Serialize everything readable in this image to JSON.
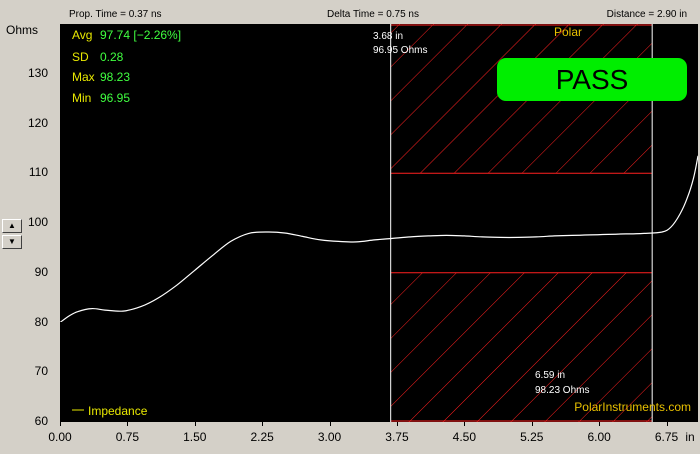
{
  "header": {
    "prop_time": "Prop. Time = 0.37 ns",
    "delta_time": "Delta Time = 0.75 ns",
    "distance": "Distance = 2.90 in"
  },
  "stats": {
    "avg_label": "Avg",
    "avg_value": "97.74 [−2.26%]",
    "sd_label": "SD",
    "sd_value": "0.28",
    "max_label": "Max",
    "max_value": "98.23",
    "min_label": "Min",
    "min_value": "96.95"
  },
  "result": {
    "pass_label": "PASS"
  },
  "brand": {
    "tag": "Polar",
    "site": "PolarInstruments.com"
  },
  "cursors": {
    "left_pos": "3.68 in",
    "left_value": "96.95 Ohms",
    "right_pos": "6.59 in",
    "right_value": "98.23 Ohms"
  },
  "spinner": {
    "up": "▲",
    "down": "▼"
  },
  "colors": {
    "plot_bg": "#000000",
    "trace": "#ffffff",
    "limit": "#ff2020",
    "cursor": "#ffffff",
    "stats_label": "#e8e800",
    "stats_value": "#40ff40",
    "pass_bg": "#00ee00",
    "brand": "#e8c000"
  },
  "chart_data": {
    "type": "line",
    "xlabel": "in",
    "ylabel": "Ohms",
    "xlim": [
      0,
      7.1
    ],
    "ylim": [
      60,
      140
    ],
    "xticks": [
      "0.00",
      "0.75",
      "1.50",
      "2.25",
      "3.00",
      "3.75",
      "4.50",
      "5.25",
      "6.00",
      "6.75"
    ],
    "yticks": [
      "60",
      "70",
      "80",
      "90",
      "100",
      "110",
      "120",
      "130"
    ],
    "limits": {
      "upper": 110,
      "lower": 90,
      "x_start": 3.68,
      "x_end": 6.59
    },
    "legend": {
      "position": "bottom-left"
    },
    "series": [
      {
        "name": "Impedance",
        "x": [
          0.0,
          0.1,
          0.2,
          0.35,
          0.5,
          0.7,
          0.9,
          1.1,
          1.3,
          1.5,
          1.7,
          1.9,
          2.1,
          2.3,
          2.5,
          2.7,
          2.9,
          3.1,
          3.3,
          3.5,
          3.7,
          3.9,
          4.1,
          4.3,
          4.5,
          4.7,
          4.9,
          5.1,
          5.3,
          5.5,
          5.7,
          5.9,
          6.1,
          6.3,
          6.5,
          6.7,
          6.8,
          6.9,
          6.98,
          7.05,
          7.1
        ],
        "y": [
          80.0,
          81.3,
          82.2,
          82.8,
          82.5,
          82.3,
          83.2,
          85.0,
          87.5,
          90.5,
          93.5,
          96.3,
          97.9,
          98.2,
          98.0,
          97.3,
          96.6,
          96.3,
          96.2,
          96.6,
          96.9,
          97.2,
          97.4,
          97.5,
          97.4,
          97.2,
          97.1,
          97.1,
          97.2,
          97.4,
          97.5,
          97.6,
          97.7,
          97.8,
          97.9,
          98.2,
          99.2,
          101.8,
          105.0,
          109.0,
          113.5
        ]
      }
    ]
  }
}
